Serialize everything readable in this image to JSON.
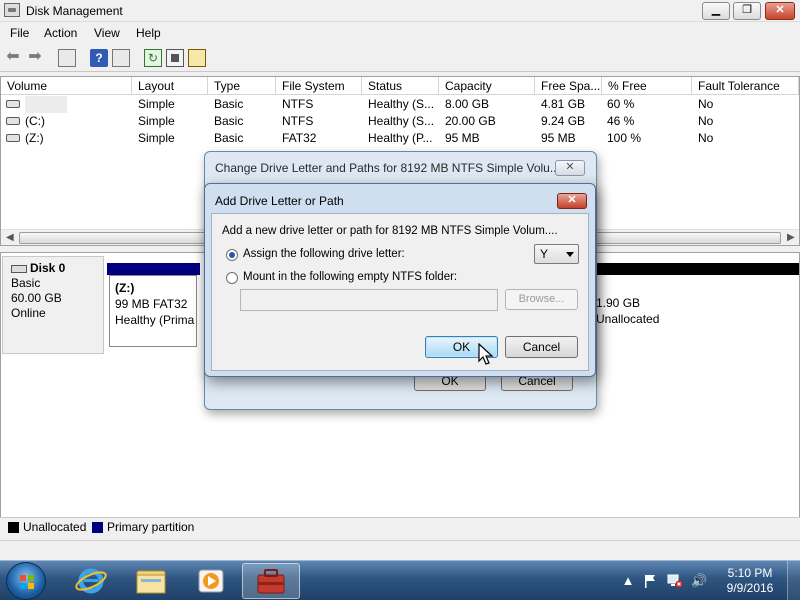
{
  "window": {
    "title": "Disk Management",
    "controls": {
      "minimize": "▁",
      "maximize": "❐",
      "close": "✕"
    }
  },
  "menu": [
    "File",
    "Action",
    "View",
    "Help"
  ],
  "toolbar": {
    "icons": [
      "back-arrow-icon",
      "forward-arrow-icon",
      "console-tree-icon",
      "help-icon",
      "show-hide-icon",
      "refresh-icon",
      "properties-icon",
      "disk-properties-icon"
    ]
  },
  "volume_list": {
    "columns": [
      "Volume",
      "Layout",
      "Type",
      "File System",
      "Status",
      "Capacity",
      "Free Spa...",
      "% Free",
      "Fault Tolerance"
    ],
    "rows": [
      {
        "volume": "",
        "layout": "Simple",
        "type": "Basic",
        "fs": "NTFS",
        "status": "Healthy (S...",
        "capacity": "8.00 GB",
        "free": "4.81 GB",
        "pct": "60 %",
        "fault": "No"
      },
      {
        "volume": "(C:)",
        "layout": "Simple",
        "type": "Basic",
        "fs": "NTFS",
        "status": "Healthy (S...",
        "capacity": "20.00 GB",
        "free": "9.24 GB",
        "pct": "46 %",
        "fault": "No"
      },
      {
        "volume": "(Z:)",
        "layout": "Simple",
        "type": "Basic",
        "fs": "FAT32",
        "status": "Healthy (P...",
        "capacity": "95 MB",
        "free": "95 MB",
        "pct": "100 %",
        "fault": "No"
      }
    ]
  },
  "disk_map": {
    "disk": {
      "name": "Disk 0",
      "type": "Basic",
      "size": "60.00 GB",
      "state": "Online"
    },
    "partitions": [
      {
        "label": "(Z:)",
        "detail": "99 MB FAT32",
        "status": "Healthy (Prima"
      },
      {
        "label": "",
        "detail": "1.90 GB",
        "status": "Unallocated"
      }
    ]
  },
  "legend": [
    {
      "label": "Unallocated",
      "color": "#000000"
    },
    {
      "label": "Primary partition",
      "color": "#00007f"
    }
  ],
  "back_dialog": {
    "title": "Change Drive Letter and Paths for 8192 MB NTFS Simple Volu...",
    "close": "✕",
    "ok": "OK",
    "cancel": "Cancel"
  },
  "dialog": {
    "title": "Add Drive Letter or Path",
    "close": "✕",
    "description": "Add a new drive letter or path for 8192 MB NTFS Simple Volum....",
    "assign_label": "Assign the following drive letter:",
    "assign_selected": true,
    "drive_letter": "Y",
    "mount_label": "Mount in the following empty NTFS folder:",
    "mount_selected": false,
    "folder_value": "",
    "browse": "Browse...",
    "ok": "OK",
    "cancel": "Cancel"
  },
  "taskbar": {
    "pinned": [
      "internet-explorer-icon",
      "explorer-folders-icon",
      "media-player-icon",
      "computer-management-icon"
    ],
    "active_index": 3,
    "tray": [
      "show-hidden-icons",
      "action-center-flag-icon",
      "network-icon",
      "volume-icon"
    ],
    "tray_glyphs": {
      "chevron": "▲",
      "volume": "🔊"
    },
    "time": "5:10 PM",
    "date": "9/9/2016"
  }
}
